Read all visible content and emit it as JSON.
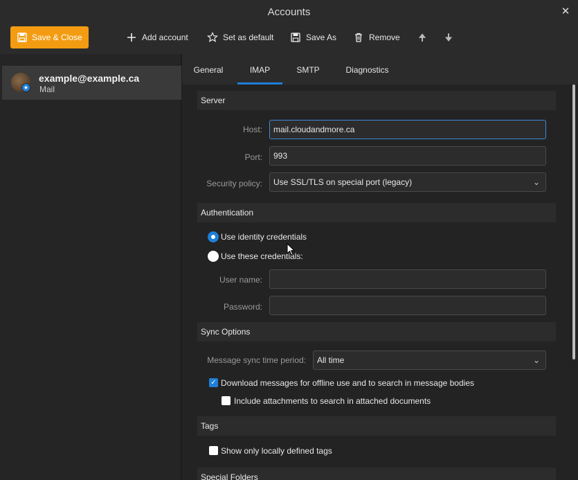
{
  "window": {
    "title": "Accounts",
    "close_glyph": "✕"
  },
  "toolbar": {
    "save_close": "Save & Close",
    "add_account": "Add account",
    "set_default": "Set as default",
    "save_as": "Save As",
    "remove": "Remove",
    "up_glyph": "🠉",
    "down_glyph": "🠋"
  },
  "account": {
    "email": "example@example.ca",
    "type": "Mail",
    "badge": "★"
  },
  "tabs": [
    {
      "label": "General"
    },
    {
      "label": "IMAP"
    },
    {
      "label": "SMTP"
    },
    {
      "label": "Diagnostics"
    }
  ],
  "server": {
    "heading": "Server",
    "host_label": "Host:",
    "host_value": "mail.cloudandmore.ca",
    "port_label": "Port:",
    "port_value": "993",
    "security_label": "Security policy:",
    "security_value": "Use SSL/TLS on special port (legacy)"
  },
  "auth": {
    "heading": "Authentication",
    "use_identity": "Use identity credentials",
    "use_these": "Use these credentials:",
    "username_label": "User name:",
    "username_value": "",
    "password_label": "Password:",
    "password_value": ""
  },
  "sync": {
    "heading": "Sync Options",
    "period_label": "Message sync time period:",
    "period_value": "All time",
    "download_label": "Download messages for offline use and to search in message bodies",
    "attachments_label": "Include attachments to search in attached documents"
  },
  "tags": {
    "heading": "Tags",
    "local_only_label": "Show only locally defined tags"
  },
  "special_folders": {
    "heading": "Special Folders"
  },
  "colors": {
    "accent": "#1e7fd8",
    "primary_button": "#f39c12"
  }
}
